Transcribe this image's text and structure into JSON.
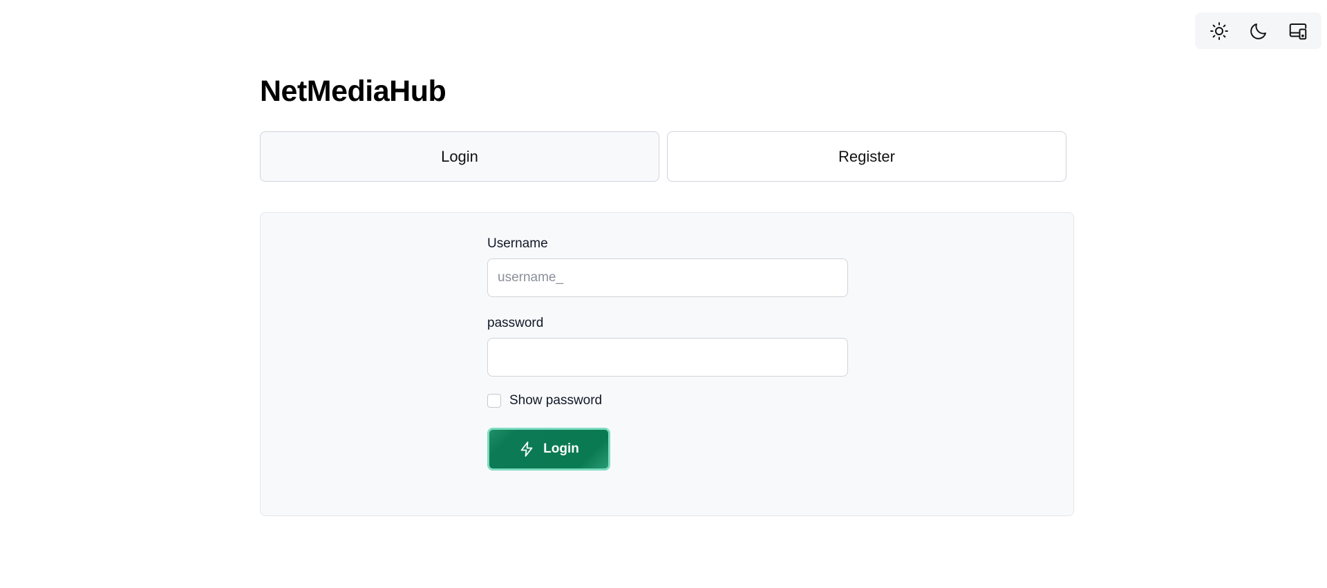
{
  "app": {
    "title": "NetMediaHub"
  },
  "theme_switcher": {
    "items": [
      {
        "icon": "sun-icon",
        "name": "light-theme-button"
      },
      {
        "icon": "moon-icon",
        "name": "dark-theme-button"
      },
      {
        "icon": "devices-icon",
        "name": "system-theme-button"
      }
    ]
  },
  "tabs": {
    "login_label": "Login",
    "register_label": "Register",
    "active": "Login"
  },
  "form": {
    "username_label": "Username",
    "username_placeholder": "username_",
    "username_value": "",
    "password_label": "password",
    "password_value": "",
    "show_password_label": "Show password",
    "show_password_checked": false,
    "submit_label": "Login",
    "submit_icon": "lightning-icon"
  },
  "colors": {
    "accent": "#0a7a52",
    "accent_ring": "#7fdcc0",
    "card_bg": "#f8f9fb",
    "border": "#cfd3da"
  }
}
